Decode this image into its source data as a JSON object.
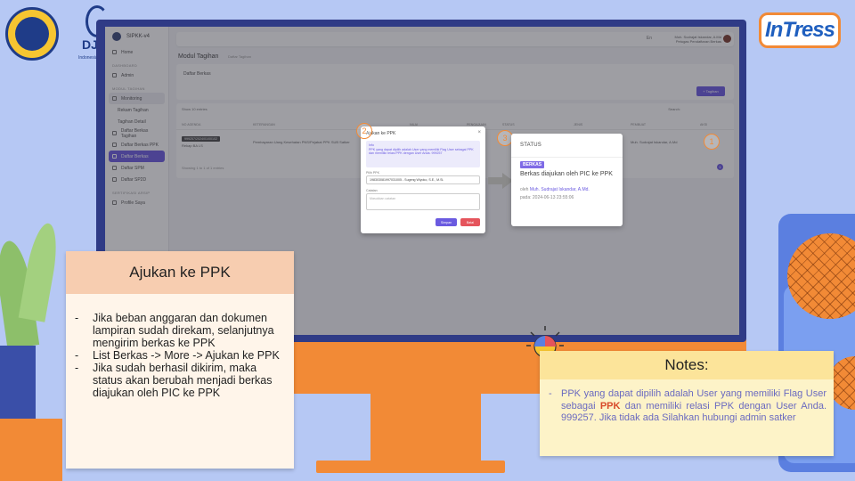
{
  "app": {
    "name": "SIPKK-v4",
    "intress_logo": "InTress",
    "djpb_logo_text": "DJPb",
    "djpb_logo_sub": "Indonesiaku"
  },
  "sidebar": {
    "home": "Home",
    "sections": [
      "DASHBOARD",
      "MODUL TAGIHAN",
      "SERTIFIKASI ARSIP"
    ],
    "items": [
      {
        "label": "Home"
      },
      {
        "label": "Admin"
      },
      {
        "label": "Monitoring"
      },
      {
        "label": "Rekam Tagihan"
      },
      {
        "label": "Tagihan Detail"
      },
      {
        "label": "Daftar Berkas Tagihan"
      },
      {
        "label": "Daftar Berkas PPK"
      },
      {
        "label": "Daftar Berkas"
      },
      {
        "label": "Daftar SPM"
      },
      {
        "label": "Daftar SP2D"
      },
      {
        "label": "Profile Saya"
      }
    ]
  },
  "topbar": {
    "user_name": "Muh. Sudrajat Iskandar, A.Md",
    "user_role": "Petugas Pendaftaran Berkas",
    "lang": "En"
  },
  "page": {
    "module_title": "Modul Tagihan",
    "module_sub": "Daftar Tagihan",
    "card_title": "Daftar Berkas",
    "add_button": "+ Tagihan",
    "show_label": "Show 10 entries",
    "search_label": "Search:",
    "columns": [
      "NO AGENDA",
      "KETERANGAN",
      "NILAI",
      "PENGAJUAN",
      "STATUS",
      "JENIS",
      "PEMBUAT",
      "AKSI"
    ],
    "row": {
      "no_agenda": "999257/2024/01/00102",
      "sub": "Rekap BA LS",
      "desc": "Pembayaran Uang Kesehatan PNS/Pejabat PPK SUB Satker",
      "creator": "Muh. Sudrajat Iskandar, A.Md",
      "date": "2024-06-13 23:55:06"
    },
    "table_info": "Showing 1 to 1 of 1 entries",
    "page_number": "1"
  },
  "modal": {
    "title": "Ajukan ke PPK",
    "close": "×",
    "info_label": "Info",
    "info_text": "PPK yang dapat dipilih adalah User yang memiliki Flag User sebagai PPK dan memiliki relasi PPK dengan User Anda. 999257",
    "ppk_label": "Pilih PPK",
    "ppk_value": "198303081997031005 - Sugeng Wiyoko, S.E., M.Si.",
    "note_label": "Catatan",
    "note_placeholder": "Masukkan catatan",
    "save": "Simpan",
    "cancel": "Batal"
  },
  "status_card": {
    "title": "STATUS",
    "badge": "BERKAS",
    "desc": "Berkas diajukan oleh PIC ke PPK",
    "by_prefix": "oleh",
    "by_name": "Muh. Sudrajat Iskandar, A.Md.",
    "date": "pada: 2024-06-13 23:55:06"
  },
  "steps": [
    "1",
    "2",
    "3"
  ],
  "left_panel": {
    "title": "Ajukan ke PPK",
    "points": [
      "Jika beban anggaran dan dokumen lampiran sudah direkam, selanjutnya mengirim berkas ke PPK",
      "List Berkas -> More -> Ajukan ke PPK",
      "Jika  sudah berhasil dikirim, maka status akan berubah menjadi berkas diajukan oleh PIC ke PPK"
    ]
  },
  "notes_panel": {
    "title": "Notes:",
    "text_before": "PPK yang dapat dipilih adalah User yang memiliki Flag User sebagai ",
    "highlight": "PPK",
    "text_after": " dan memiliki relasi PPK dengan User Anda. 999257. Jika tidak ada Silahkan hubungi admin satker"
  },
  "colors": {
    "background": "#b6c8f4",
    "monitor": "#2f3b86",
    "accent_orange": "#f28a36",
    "accent_purple": "#6a5ae0",
    "notes_header": "#fce49a",
    "left_header": "#f7cdb0"
  },
  "icons": [
    "kemenkeu-logo",
    "djpb-logo",
    "intress-logo",
    "arrow-right-icon",
    "lightbulb-icon",
    "close-icon",
    "user-avatar"
  ]
}
